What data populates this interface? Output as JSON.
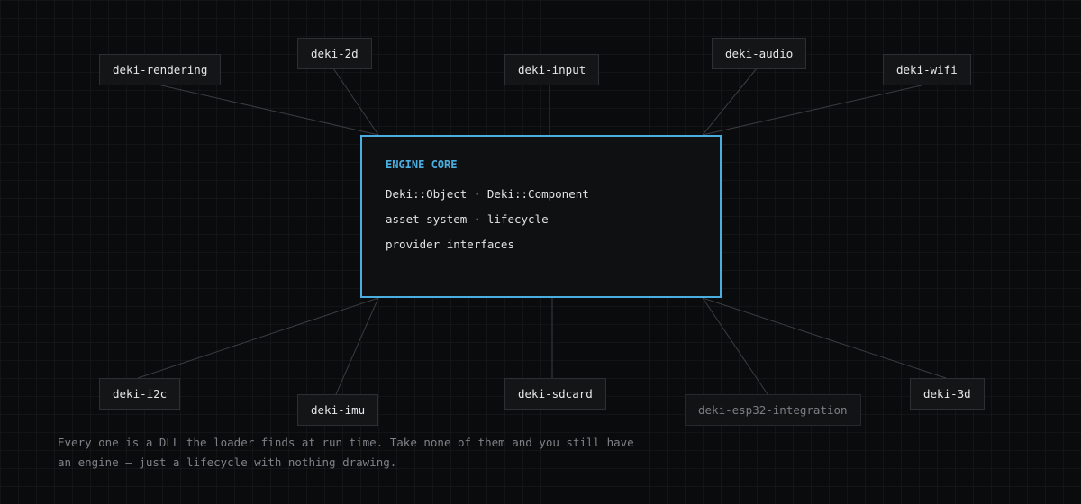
{
  "core": {
    "title": "ENGINE CORE",
    "lines": [
      "Deki::Object · Deki::Component",
      "asset system · lifecycle",
      "provider interfaces"
    ]
  },
  "modules_top": [
    "deki-rendering",
    "deki-2d",
    "deki-input",
    "deki-audio",
    "deki-wifi"
  ],
  "modules_bottom": [
    "deki-i2c",
    "deki-imu",
    "deki-sdcard",
    "deki-esp32-integration",
    "deki-3d"
  ],
  "caption": "Every one is a DLL the loader finds at run time. Take none of them and you still have an engine — just a lifecycle with nothing drawing.",
  "colors": {
    "accent": "#4aaee0",
    "background": "#0a0b0d",
    "muted_module_text": "#7b7f85"
  }
}
